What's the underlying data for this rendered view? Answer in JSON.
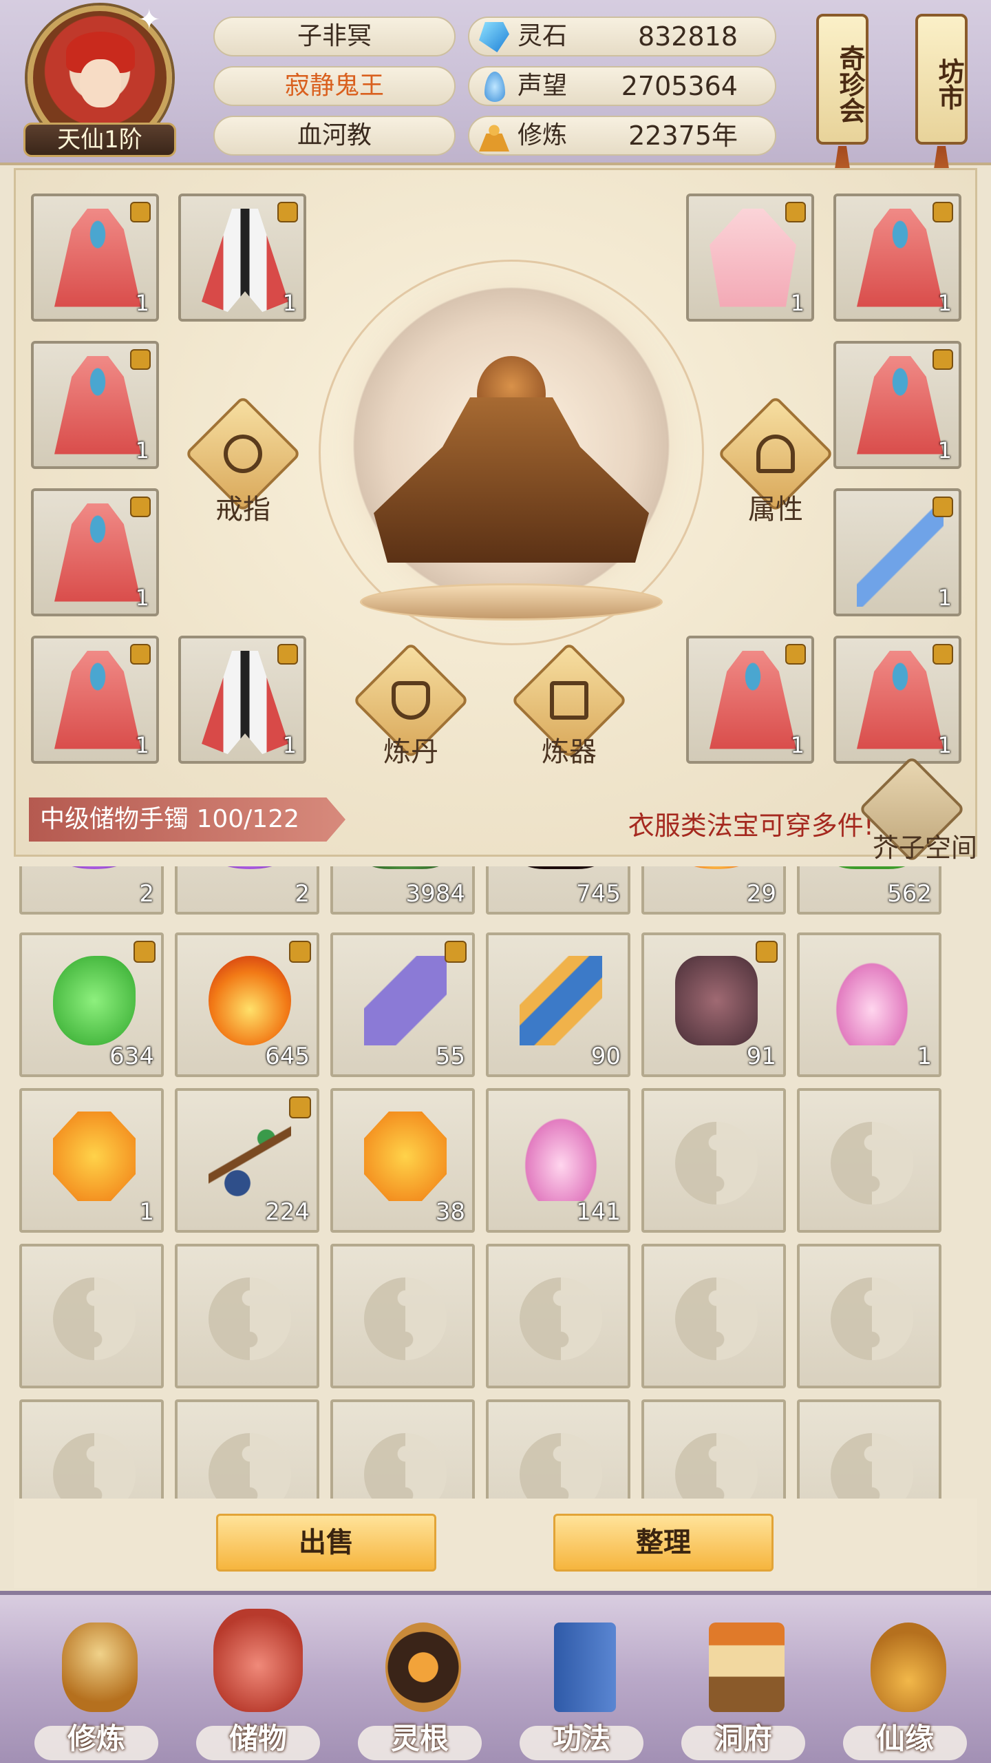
{
  "header": {
    "realm_badge": "天仙1阶",
    "player_name": "子非冥",
    "title": "寂静鬼王",
    "sect": "血河教",
    "title_color": "#d9601e",
    "resources": [
      {
        "label": "灵石",
        "value": "832818",
        "icon": "spirit-stone-icon"
      },
      {
        "label": "声望",
        "value": "2705364",
        "icon": "reputation-icon"
      },
      {
        "label": "修炼",
        "value": "22375年",
        "icon": "cultivation-icon"
      }
    ],
    "banners": [
      {
        "label": "奇珍会"
      },
      {
        "label": "坊市"
      }
    ]
  },
  "equipment": {
    "left_slots": [
      {
        "count": "1",
        "locked": true,
        "kind": "red-robe"
      },
      {
        "count": "1",
        "locked": true,
        "kind": "white-robe"
      },
      {
        "count": "1",
        "locked": true,
        "kind": "red-robe"
      },
      {
        "count": "1",
        "locked": true,
        "kind": "red-robe"
      },
      {
        "count": "1",
        "locked": true,
        "kind": "red-robe"
      },
      {
        "count": "1",
        "locked": true,
        "kind": "white-robe"
      }
    ],
    "right_slots": [
      {
        "count": "1",
        "locked": true,
        "kind": "pink-robe"
      },
      {
        "count": "1",
        "locked": true,
        "kind": "red-robe"
      },
      {
        "count": "1",
        "locked": true,
        "kind": "red-robe"
      },
      {
        "count": "1",
        "locked": true,
        "kind": "sword"
      },
      {
        "count": "1",
        "locked": true,
        "kind": "red-robe"
      },
      {
        "count": "1",
        "locked": true,
        "kind": "red-robe"
      }
    ],
    "functions": {
      "ring": "戒指",
      "attributes": "属性",
      "alchemy": "炼丹",
      "forge": "炼器"
    }
  },
  "storage": {
    "container_label": "中级储物手镯 100/122",
    "hint": "衣服类法宝可穿多件!",
    "hint_color": "#a5291f",
    "space_label": "芥子空间",
    "top_row_counts": [
      "2",
      "2",
      "3984",
      "745",
      "29",
      "562"
    ],
    "items": [
      {
        "count": "634",
        "locked": true,
        "icon": "green-jade-icon"
      },
      {
        "count": "645",
        "locked": true,
        "icon": "fire-orb-icon"
      },
      {
        "count": "55",
        "locked": true,
        "icon": "talisman-icon"
      },
      {
        "count": "90",
        "locked": false,
        "icon": "scroll-icon"
      },
      {
        "count": "91",
        "locked": true,
        "icon": "ore-icon"
      },
      {
        "count": "1",
        "locked": false,
        "icon": "lotus-icon"
      },
      {
        "count": "1",
        "locked": false,
        "icon": "amber-gem-icon"
      },
      {
        "count": "224",
        "locked": true,
        "icon": "fruit-branch-icon"
      },
      {
        "count": "38",
        "locked": false,
        "icon": "amber-gem-icon"
      },
      {
        "count": "141",
        "locked": false,
        "icon": "lotus-icon"
      }
    ]
  },
  "actions": {
    "sell": "出售",
    "arrange": "整理"
  },
  "nav": [
    {
      "label": "修炼",
      "icon": "cultivate-icon"
    },
    {
      "label": "储物",
      "icon": "storage-bag-icon"
    },
    {
      "label": "灵根",
      "icon": "spirit-root-icon"
    },
    {
      "label": "功法",
      "icon": "technique-book-icon"
    },
    {
      "label": "洞府",
      "icon": "cave-house-icon"
    },
    {
      "label": "仙缘",
      "icon": "gourd-icon"
    }
  ]
}
